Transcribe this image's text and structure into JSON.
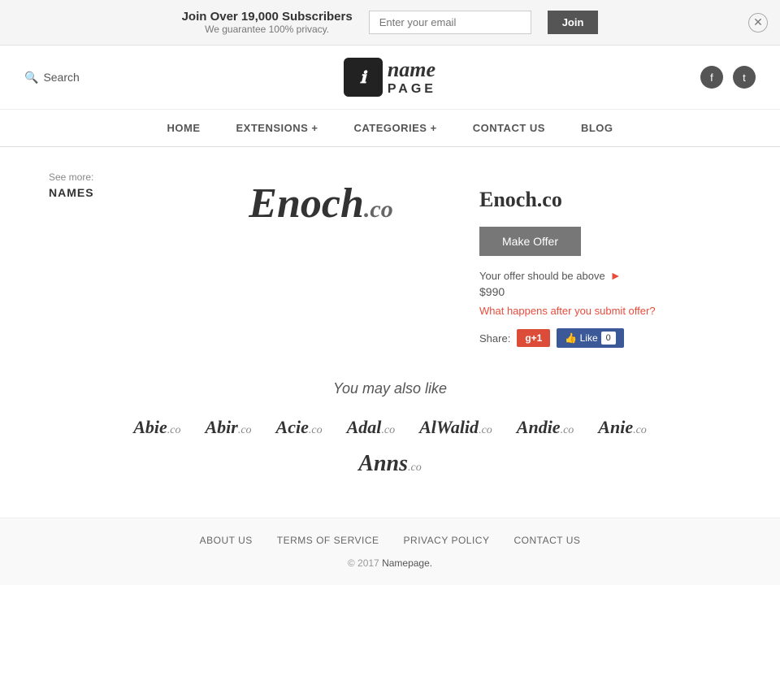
{
  "banner": {
    "title": "Join Over 19,000 Subscribers",
    "subtitle": "We guarantee 100% privacy.",
    "email_placeholder": "Enter your email",
    "join_label": "Join"
  },
  "header": {
    "search_label": "Search",
    "logo_icon": "n",
    "logo_name": "name",
    "logo_page": "PAGE"
  },
  "nav": {
    "items": [
      {
        "label": "HOME"
      },
      {
        "label": "EXTENSIONS +"
      },
      {
        "label": "CATEGORIES +"
      },
      {
        "label": "CONTACT US"
      },
      {
        "label": "BLOG"
      }
    ]
  },
  "sidebar": {
    "see_more_label": "See more:",
    "link_label": "NAMES"
  },
  "domain": {
    "name": "Enoch",
    "tld": ".co",
    "full": "Enoch.co",
    "make_offer_label": "Make Offer",
    "offer_hint": "Your offer should be above",
    "offer_price": "$990",
    "offer_link": "What happens after you submit offer?",
    "share_label": "Share:"
  },
  "also_like": {
    "title": "You may also like",
    "items": [
      {
        "name": "Abie",
        "tld": ".co"
      },
      {
        "name": "Abir",
        "tld": ".co"
      },
      {
        "name": "Acie",
        "tld": ".co"
      },
      {
        "name": "Adal",
        "tld": ".co"
      },
      {
        "name": "AlWalid",
        "tld": ".co"
      },
      {
        "name": "Andie",
        "tld": ".co"
      },
      {
        "name": "Anie",
        "tld": ".co"
      },
      {
        "name": "Anns",
        "tld": ".co"
      }
    ]
  },
  "footer": {
    "links": [
      {
        "label": "ABOUT US"
      },
      {
        "label": "TERMS OF SERVICE"
      },
      {
        "label": "PRIVACY POLICY"
      },
      {
        "label": "CONTACT US"
      }
    ],
    "copyright": "© 2017 Namepage."
  }
}
